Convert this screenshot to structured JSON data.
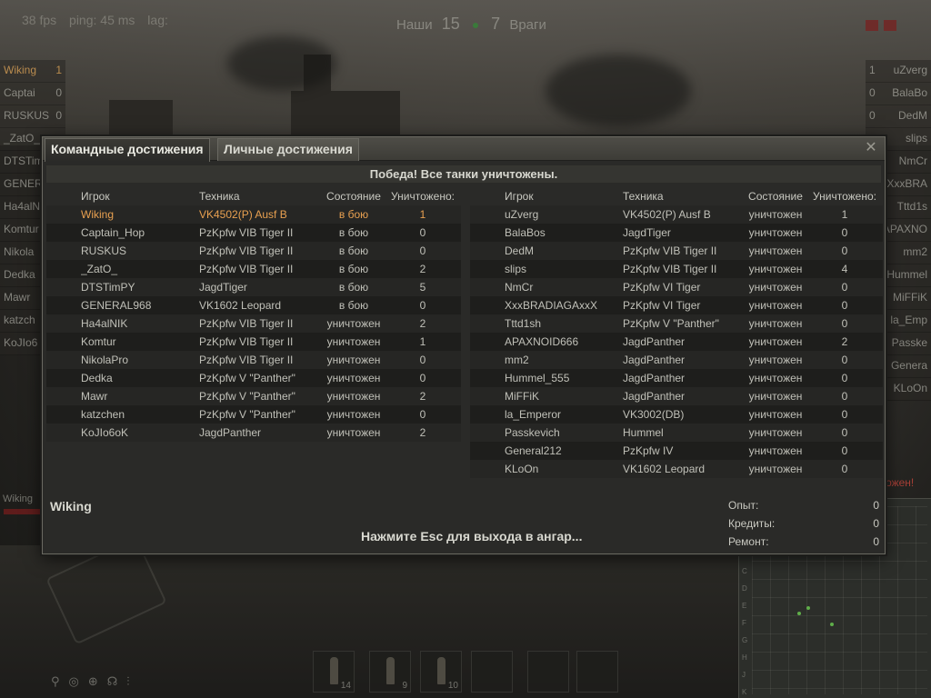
{
  "hud": {
    "fps": "38 fps",
    "ping": "ping: 45 ms",
    "lag": "lag:",
    "allies_label": "Наши",
    "allies_score": "15",
    "enemies_score": "7",
    "enemies_label": "Враги"
  },
  "side_left": [
    "Wiking",
    "Captai",
    "RUSKUS",
    "_ZatO_",
    "DTSTim",
    "GENERA",
    "Ha4alN",
    "Komtur",
    "Nikola",
    "Dedka",
    "Mawr",
    "katzch",
    "KoJIo6"
  ],
  "side_left_counts": [
    "1",
    "0",
    "0"
  ],
  "side_right": [
    "uZverg",
    "BalaBo",
    "DedM",
    "slips",
    "NmCr",
    "XxxBRA",
    "Tttd1s",
    "APAXNO",
    "mm2",
    "Hummel",
    "MiFFiK",
    "la_Emp",
    "Passke",
    "Genera",
    "KLoOn"
  ],
  "side_right_counts": [
    "1",
    "0",
    "0"
  ],
  "partial_victory": "итожен!",
  "bottom_left": {
    "name": "Wiking"
  },
  "ammo": [
    {
      "count": "14"
    },
    {
      "count": "9"
    },
    {
      "count": "10"
    }
  ],
  "minimap_letters": [
    "C",
    "D",
    "E",
    "F",
    "G",
    "H",
    "J",
    "K"
  ],
  "dialog": {
    "tabs": [
      "Командные достижения",
      "Личные достижения"
    ],
    "close": "✕",
    "result": "Победа! Все танки уничтожены.",
    "headers": {
      "player": "Игрок",
      "tank": "Техника",
      "state": "Состояние",
      "kills": "Уничтожено:"
    },
    "team_left": [
      {
        "player": "Wiking",
        "tank": "VK4502(P) Ausf B",
        "state": "в бою",
        "kills": "1"
      },
      {
        "player": "Captain_Hop",
        "tank": "PzKpfw VIB Tiger II",
        "state": "в бою",
        "kills": "0"
      },
      {
        "player": "RUSKUS",
        "tank": "PzKpfw VIB Tiger II",
        "state": "в бою",
        "kills": "0"
      },
      {
        "player": "_ZatO_",
        "tank": "PzKpfw VIB Tiger II",
        "state": "в бою",
        "kills": "2"
      },
      {
        "player": "DTSTimPY",
        "tank": "JagdTiger",
        "state": "в бою",
        "kills": "5"
      },
      {
        "player": "GENERAL968",
        "tank": "VK1602 Leopard",
        "state": "в бою",
        "kills": "0"
      },
      {
        "player": "Ha4alNIK",
        "tank": "PzKpfw VIB Tiger II",
        "state": "уничтожен",
        "kills": "2"
      },
      {
        "player": "Komtur",
        "tank": "PzKpfw VIB Tiger II",
        "state": "уничтожен",
        "kills": "1"
      },
      {
        "player": "NikolaPro",
        "tank": "PzKpfw VIB Tiger II",
        "state": "уничтожен",
        "kills": "0"
      },
      {
        "player": "Dedka",
        "tank": "PzKpfw V \"Panther\"",
        "state": "уничтожен",
        "kills": "0"
      },
      {
        "player": "Mawr",
        "tank": "PzKpfw V \"Panther\"",
        "state": "уничтожен",
        "kills": "2"
      },
      {
        "player": "katzchen",
        "tank": "PzKpfw V \"Panther\"",
        "state": "уничтожен",
        "kills": "0"
      },
      {
        "player": "KoJIo6oK",
        "tank": "JagdPanther",
        "state": "уничтожен",
        "kills": "2"
      }
    ],
    "team_right": [
      {
        "player": "uZverg",
        "tank": "VK4502(P) Ausf B",
        "state": "уничтожен",
        "kills": "1"
      },
      {
        "player": "BalaBos",
        "tank": "JagdTiger",
        "state": "уничтожен",
        "kills": "0"
      },
      {
        "player": "DedM",
        "tank": "PzKpfw VIB Tiger II",
        "state": "уничтожен",
        "kills": "0"
      },
      {
        "player": "slips",
        "tank": "PzKpfw VIB Tiger II",
        "state": "уничтожен",
        "kills": "4"
      },
      {
        "player": "NmCr",
        "tank": "PzKpfw VI Tiger",
        "state": "уничтожен",
        "kills": "0"
      },
      {
        "player": "XxxBRADIAGAxxX",
        "tank": "PzKpfw VI Tiger",
        "state": "уничтожен",
        "kills": "0"
      },
      {
        "player": "Tttd1sh",
        "tank": "PzKpfw V \"Panther\"",
        "state": "уничтожен",
        "kills": "0"
      },
      {
        "player": "APAXNOID666",
        "tank": "JagdPanther",
        "state": "уничтожен",
        "kills": "2"
      },
      {
        "player": "mm2",
        "tank": "JagdPanther",
        "state": "уничтожен",
        "kills": "0"
      },
      {
        "player": "Hummel_555",
        "tank": "JagdPanther",
        "state": "уничтожен",
        "kills": "0"
      },
      {
        "player": "MiFFiK",
        "tank": "JagdPanther",
        "state": "уничтожен",
        "kills": "0"
      },
      {
        "player": "la_Emperor",
        "tank": "VK3002(DB)",
        "state": "уничтожен",
        "kills": "0"
      },
      {
        "player": "Passkevich",
        "tank": "Hummel",
        "state": "уничтожен",
        "kills": "0"
      },
      {
        "player": "General212",
        "tank": "PzKpfw IV",
        "state": "уничтожен",
        "kills": "0"
      },
      {
        "player": "KLoOn",
        "tank": "VK1602 Leopard",
        "state": "уничтожен",
        "kills": "0"
      }
    ],
    "player_name": "Wiking",
    "hint": "Нажмите Esc для выхода в ангар...",
    "stats": [
      {
        "label": "Опыт:",
        "value": "0"
      },
      {
        "label": "Кредиты:",
        "value": "0"
      },
      {
        "label": "Ремонт:",
        "value": "0"
      }
    ]
  }
}
